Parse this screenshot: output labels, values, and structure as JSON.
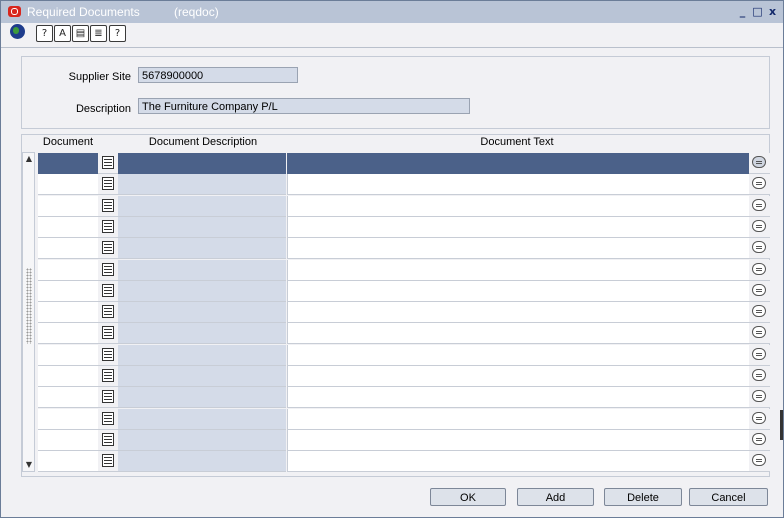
{
  "window": {
    "title": "Required Documents",
    "form_code": "(reqdoc)",
    "controls": {
      "minimize": "_",
      "maximize": "□",
      "close": "x"
    }
  },
  "toolbar": {
    "icons": [
      "globe-icon",
      "help-icon",
      "find-icon",
      "clipboard-icon",
      "document-icon",
      "question-icon"
    ],
    "glyphs": {
      "help": "?",
      "find": "A",
      "clip": "▤",
      "doc": "≣",
      "question": "?"
    }
  },
  "header": {
    "supplier_site_label": "Supplier Site",
    "supplier_site_value": "5678900000",
    "description_label": "Description",
    "description_value": "The Furniture Company P/L"
  },
  "grid": {
    "columns": [
      "Document",
      "Document Description",
      "Document Text"
    ],
    "row_count": 15,
    "selected_row": 0,
    "scroll_up": "▲",
    "scroll_down": "▼"
  },
  "buttons": {
    "ok": "OK",
    "add": "Add",
    "delete": "Delete",
    "cancel": "Cancel"
  },
  "colors": {
    "selection": "#4b6189",
    "readonly_field": "#d4dbe8",
    "title_bar": "#b9c4d6"
  }
}
